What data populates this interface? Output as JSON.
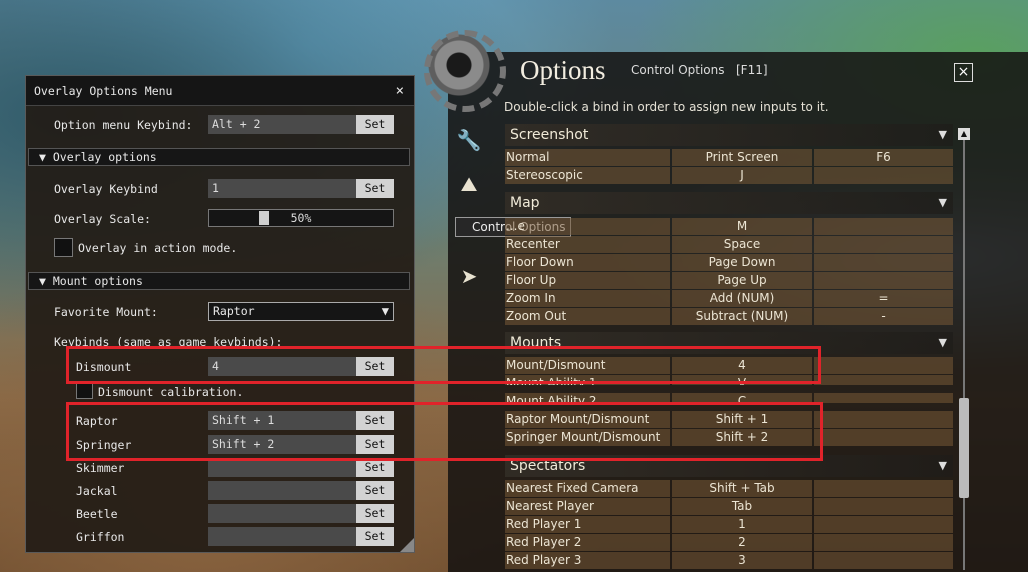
{
  "overlay": {
    "title": "Overlay Options Menu",
    "close": "×",
    "option_menu_keybind_label": "Option menu Keybind:",
    "option_menu_keybind_value": "Alt + 2",
    "set": "Set",
    "overlay_options_header": "Overlay options",
    "overlay_keybind_label": "Overlay Keybind",
    "overlay_keybind_value": "1",
    "overlay_scale_label": "Overlay Scale:",
    "overlay_scale_value": "50%",
    "overlay_action_mode_label": "Overlay in action mode.",
    "mount_options_header": "Mount options",
    "favorite_mount_label": "Favorite Mount:",
    "favorite_mount_value": "Raptor",
    "keybinds_label": "Keybinds (same as game keybinds):",
    "dismount_label": "Dismount",
    "dismount_value": "4",
    "dismount_calibration_label": "Dismount calibration.",
    "mounts": [
      {
        "name": "Raptor",
        "value": "Shift + 1"
      },
      {
        "name": "Springer",
        "value": "Shift + 2"
      },
      {
        "name": "Skimmer",
        "value": ""
      },
      {
        "name": "Jackal",
        "value": ""
      },
      {
        "name": "Beetle",
        "value": ""
      },
      {
        "name": "Griffon",
        "value": ""
      }
    ]
  },
  "game": {
    "title": "Options",
    "subtitle": "Control Options",
    "hotkey": "[F11]",
    "close": "×",
    "hint": "Double-click a bind in order to assign new inputs to it.",
    "tooltip": "Control Options",
    "sections": {
      "screenshot": "Screenshot",
      "map": "Map",
      "mounts": "Mounts",
      "spectators": "Spectators"
    },
    "screenshot_rows": [
      {
        "action": "Normal",
        "primary": "Print Screen",
        "secondary": "F6"
      },
      {
        "action": "Stereoscopic",
        "primary": "J",
        "secondary": ""
      }
    ],
    "map_rows": [
      {
        "action": "...e",
        "primary": "M",
        "secondary": ""
      },
      {
        "action": "Recenter",
        "primary": "Space",
        "secondary": ""
      },
      {
        "action": "Floor Down",
        "primary": "Page Down",
        "secondary": ""
      },
      {
        "action": "Floor Up",
        "primary": "Page Up",
        "secondary": ""
      },
      {
        "action": "Zoom In",
        "primary": "Add (NUM)",
        "secondary": "="
      },
      {
        "action": "Zoom Out",
        "primary": "Subtract (NUM)",
        "secondary": "-"
      }
    ],
    "mount_rows": [
      {
        "action": "Mount/Dismount",
        "primary": "4",
        "secondary": ""
      },
      {
        "action": "Mount Ability 1",
        "primary": "V",
        "secondary": ""
      },
      {
        "action": "Mount Ability 2",
        "primary": "C",
        "secondary": ""
      },
      {
        "action": "Raptor Mount/Dismount",
        "primary": "Shift + 1",
        "secondary": ""
      },
      {
        "action": "Springer Mount/Dismount",
        "primary": "Shift + 2",
        "secondary": ""
      }
    ],
    "spectator_rows": [
      {
        "action": "Nearest Fixed Camera",
        "primary": "Shift + Tab",
        "secondary": ""
      },
      {
        "action": "Nearest Player",
        "primary": "Tab",
        "secondary": ""
      },
      {
        "action": "Red Player 1",
        "primary": "1",
        "secondary": ""
      },
      {
        "action": "Red Player 2",
        "primary": "2",
        "secondary": ""
      },
      {
        "action": "Red Player 3",
        "primary": "3",
        "secondary": ""
      }
    ]
  },
  "colors": {
    "highlight": "#e0232a"
  }
}
